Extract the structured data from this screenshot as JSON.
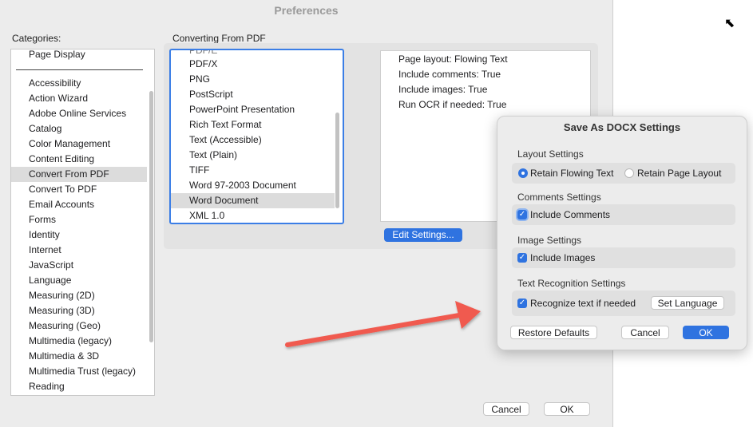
{
  "window": {
    "title": "Preferences"
  },
  "categories": {
    "label": "Categories:",
    "top_item": "Page Display",
    "items": [
      "Accessibility",
      "Action Wizard",
      "Adobe Online Services",
      "Catalog",
      "Color Management",
      "Content Editing",
      "Convert From PDF",
      "Convert To PDF",
      "Email Accounts",
      "Forms",
      "Identity",
      "Internet",
      "JavaScript",
      "Language",
      "Measuring (2D)",
      "Measuring (3D)",
      "Measuring (Geo)",
      "Multimedia (legacy)",
      "Multimedia & 3D",
      "Multimedia Trust (legacy)",
      "Reading"
    ],
    "selected": "Convert From PDF"
  },
  "converting": {
    "label": "Converting From PDF",
    "formats": [
      "PDF/X",
      "PNG",
      "PostScript",
      "PowerPoint Presentation",
      "Rich Text Format",
      "Text (Accessible)",
      "Text (Plain)",
      "TIFF",
      "Word 97-2003 Document",
      "Word Document",
      "XML 1.0"
    ],
    "partial_top": "PDF/E",
    "selected": "Word Document",
    "info": [
      "Page layout: Flowing Text",
      "Include comments: True",
      "Include images: True",
      "Run OCR if needed: True"
    ],
    "edit_button": "Edit Settings..."
  },
  "footer": {
    "cancel": "Cancel",
    "ok": "OK"
  },
  "dialog": {
    "title": "Save As DOCX Settings",
    "layout": {
      "title": "Layout Settings",
      "option_flowing": "Retain Flowing Text",
      "option_page": "Retain Page Layout",
      "selected": "Retain Flowing Text"
    },
    "comments": {
      "title": "Comments Settings",
      "label": "Include Comments",
      "checked": true
    },
    "images": {
      "title": "Image Settings",
      "label": "Include Images",
      "checked": true
    },
    "ocr": {
      "title": "Text Recognition Settings",
      "label": "Recognize text if needed",
      "checked": true,
      "set_language": "Set Language"
    },
    "restore_defaults": "Restore Defaults",
    "cancel": "Cancel",
    "ok": "OK"
  },
  "colors": {
    "accent": "#2f73e0",
    "arrow": "#f05a4f"
  }
}
